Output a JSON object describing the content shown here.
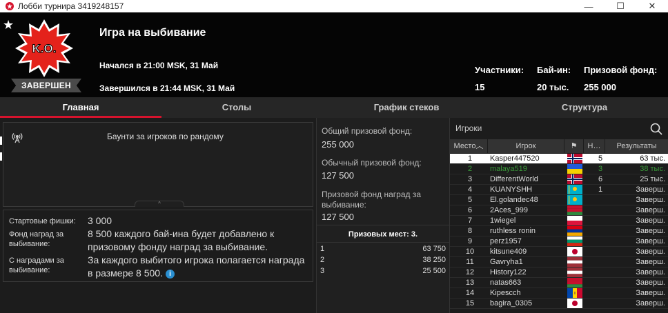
{
  "window": {
    "title": "Лобби турнира 3419248157",
    "min_symbol": "—",
    "max_symbol": "☐",
    "close_symbol": "✕"
  },
  "header": {
    "star": "★",
    "logo_text": "K.O.",
    "status": "ЗАВЕРШЕН",
    "game_title": "Игра на выбивание",
    "started": "Начался в 21:00 MSK, 31 Май",
    "finished": "Завершился в 21:44 MSK, 31 Май",
    "stats": [
      {
        "label": "Участники:",
        "value": "15"
      },
      {
        "label": "Бай-ин:",
        "value": "20 тыс."
      },
      {
        "label": "Призовой фонд:",
        "value": "255 000"
      }
    ]
  },
  "tabs": [
    {
      "label": "Главная",
      "active": true
    },
    {
      "label": "Столы",
      "active": false
    },
    {
      "label": "График стеков",
      "active": false
    },
    {
      "label": "Структура",
      "active": false
    }
  ],
  "news": {
    "icon": "broadcast-icon",
    "text": "Баунти за игроков по рандому",
    "handle": "^"
  },
  "info": {
    "starting_chips_label": "Стартовые фишки:",
    "starting_chips_value": "3 000",
    "ko_fund_label": "Фонд наград за выбивание:",
    "ko_fund_value": "8 500 каждого бай-ина будет добавлено к призовому фонду наград за выбивание.",
    "with_rewards_label": "С наградами за выбивание:",
    "with_rewards_value": "За каждого выбитого игрока полагается награда в размере 8 500.",
    "info_icon": "i"
  },
  "prize": {
    "total_label": "Общий призовой фонд:",
    "total_value": "255 000",
    "regular_label": "Обычный призовой фонд:",
    "regular_value": "127 500",
    "ko_label": "Призовой фонд наград за выбивание:",
    "ko_value": "127 500",
    "places_header": "Призовых мест: 3.",
    "places": [
      {
        "place": "1",
        "prize": "63 750"
      },
      {
        "place": "2",
        "prize": "38 250"
      },
      {
        "place": "3",
        "prize": "25 500"
      }
    ]
  },
  "players": {
    "search_placeholder": "Игроки",
    "headers": {
      "place": "Место",
      "sort_arrow": "︿",
      "player": "Игрок",
      "flag": "⚑",
      "n": "Н…",
      "results": "Результаты"
    },
    "rows": [
      {
        "place": "1",
        "name": "Kasper447520",
        "flag": "norway",
        "n": "5",
        "result": "63 тыс.",
        "style": "me"
      },
      {
        "place": "2",
        "name": "malaya519",
        "flag": "ukraine",
        "n": "3",
        "result": "38 тыс.",
        "style": "hl"
      },
      {
        "place": "3",
        "name": "DifferentWorld",
        "flag": "norway",
        "n": "6",
        "result": "25 тыс.",
        "style": ""
      },
      {
        "place": "4",
        "name": "KUANYSHH",
        "flag": "kazakhstan",
        "n": "1",
        "result": "Заверш.",
        "style": ""
      },
      {
        "place": "5",
        "name": "El.golandec48",
        "flag": "kazakhstan",
        "n": "",
        "result": "Заверш.",
        "style": ""
      },
      {
        "place": "6",
        "name": "2Aces_999",
        "flag": "belarus",
        "n": "",
        "result": "Заверш.",
        "style": ""
      },
      {
        "place": "7",
        "name": "1wiegel",
        "flag": "poland",
        "n": "",
        "result": "Заверш.",
        "style": ""
      },
      {
        "place": "8",
        "name": "ruthless ronin",
        "flag": "armenia",
        "n": "",
        "result": "Заверш.",
        "style": ""
      },
      {
        "place": "9",
        "name": "perz1957",
        "flag": "bulgaria",
        "n": "",
        "result": "Заверш.",
        "style": ""
      },
      {
        "place": "10",
        "name": "kitsune409",
        "flag": "japan",
        "n": "",
        "result": "Заверш.",
        "style": ""
      },
      {
        "place": "11",
        "name": "Gavryha1",
        "flag": "latvia",
        "n": "",
        "result": "Заверш.",
        "style": ""
      },
      {
        "place": "12",
        "name": "History122",
        "flag": "latvia",
        "n": "",
        "result": "Заверш.",
        "style": ""
      },
      {
        "place": "13",
        "name": "natas663",
        "flag": "belarus",
        "n": "",
        "result": "Заверш.",
        "style": ""
      },
      {
        "place": "14",
        "name": "Kipescch",
        "flag": "moldova",
        "n": "",
        "result": "Заверш.",
        "style": ""
      },
      {
        "place": "15",
        "name": "bagira_0305",
        "flag": "japan",
        "n": "",
        "result": "Заверш.",
        "style": ""
      }
    ]
  }
}
